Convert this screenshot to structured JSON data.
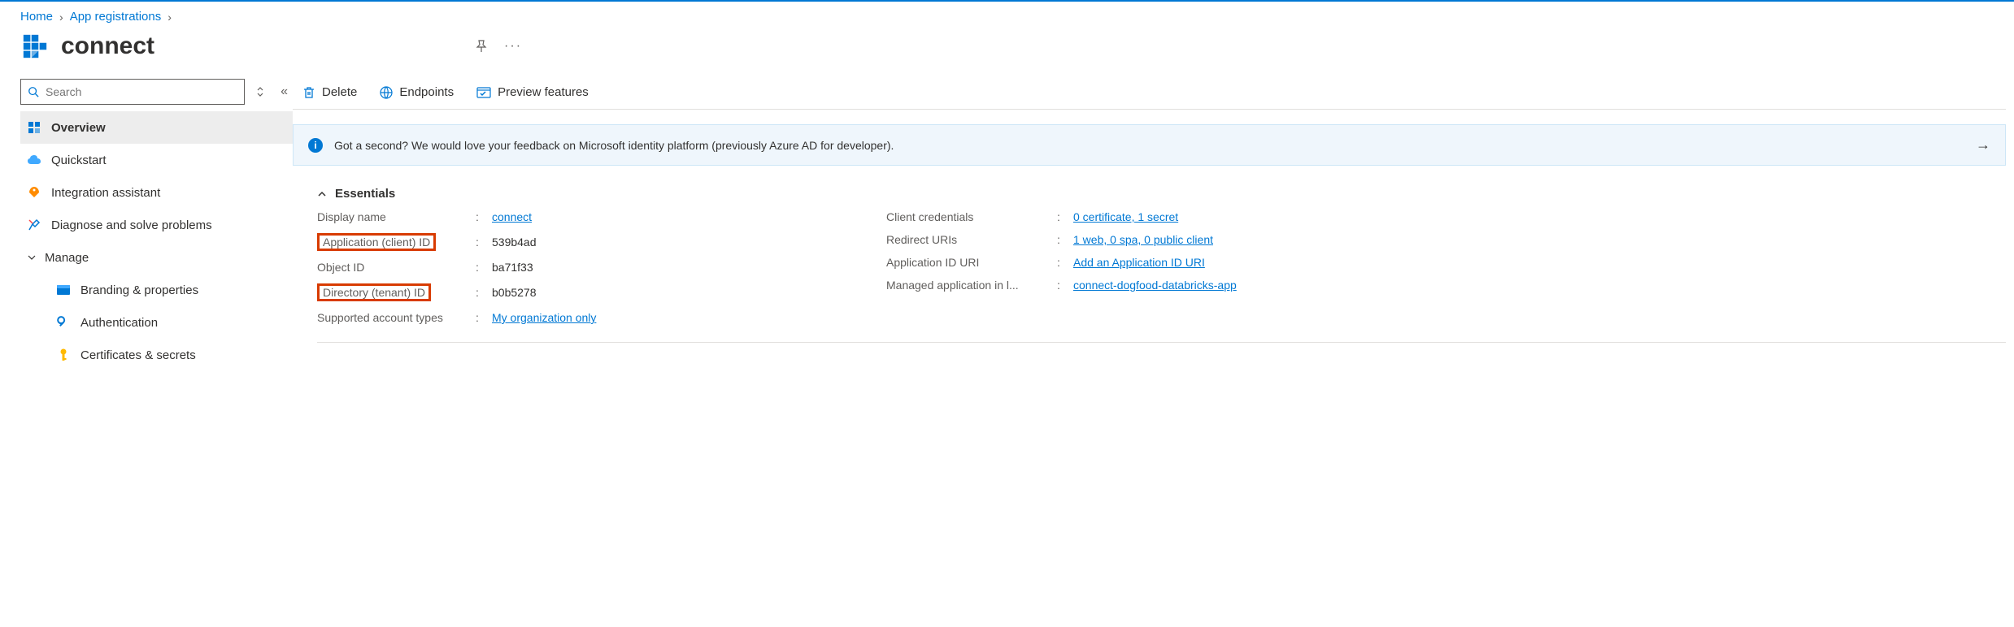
{
  "breadcrumb": {
    "home": "Home",
    "app_registrations": "App registrations"
  },
  "page_title": "connect",
  "search": {
    "placeholder": "Search"
  },
  "sidebar": {
    "items": [
      {
        "label": "Overview"
      },
      {
        "label": "Quickstart"
      },
      {
        "label": "Integration assistant"
      },
      {
        "label": "Diagnose and solve problems"
      }
    ],
    "manage_header": "Manage",
    "manage_items": [
      {
        "label": "Branding & properties"
      },
      {
        "label": "Authentication"
      },
      {
        "label": "Certificates & secrets"
      }
    ]
  },
  "commands": {
    "delete": "Delete",
    "endpoints": "Endpoints",
    "preview": "Preview features"
  },
  "info_bar": "Got a second? We would love your feedback on Microsoft identity platform (previously Azure AD for developer).",
  "essentials": {
    "header": "Essentials",
    "left": {
      "display_name_label": "Display name",
      "display_name_value": "connect",
      "client_id_label": "Application (client) ID",
      "client_id_value": "539b4ad",
      "object_id_label": "Object ID",
      "object_id_value": "ba71f33",
      "tenant_id_label": "Directory (tenant) ID",
      "tenant_id_value": "b0b5278",
      "account_types_label": "Supported account types",
      "account_types_value": "My organization only"
    },
    "right": {
      "client_creds_label": "Client credentials",
      "client_creds_value": "0 certificate, 1 secret",
      "redirect_uris_label": "Redirect URIs",
      "redirect_uris_value": "1 web, 0 spa, 0 public client",
      "app_id_uri_label": "Application ID URI",
      "app_id_uri_value": "Add an Application ID URI",
      "managed_app_label": "Managed application in l...",
      "managed_app_value": "connect-dogfood-databricks-app"
    }
  }
}
